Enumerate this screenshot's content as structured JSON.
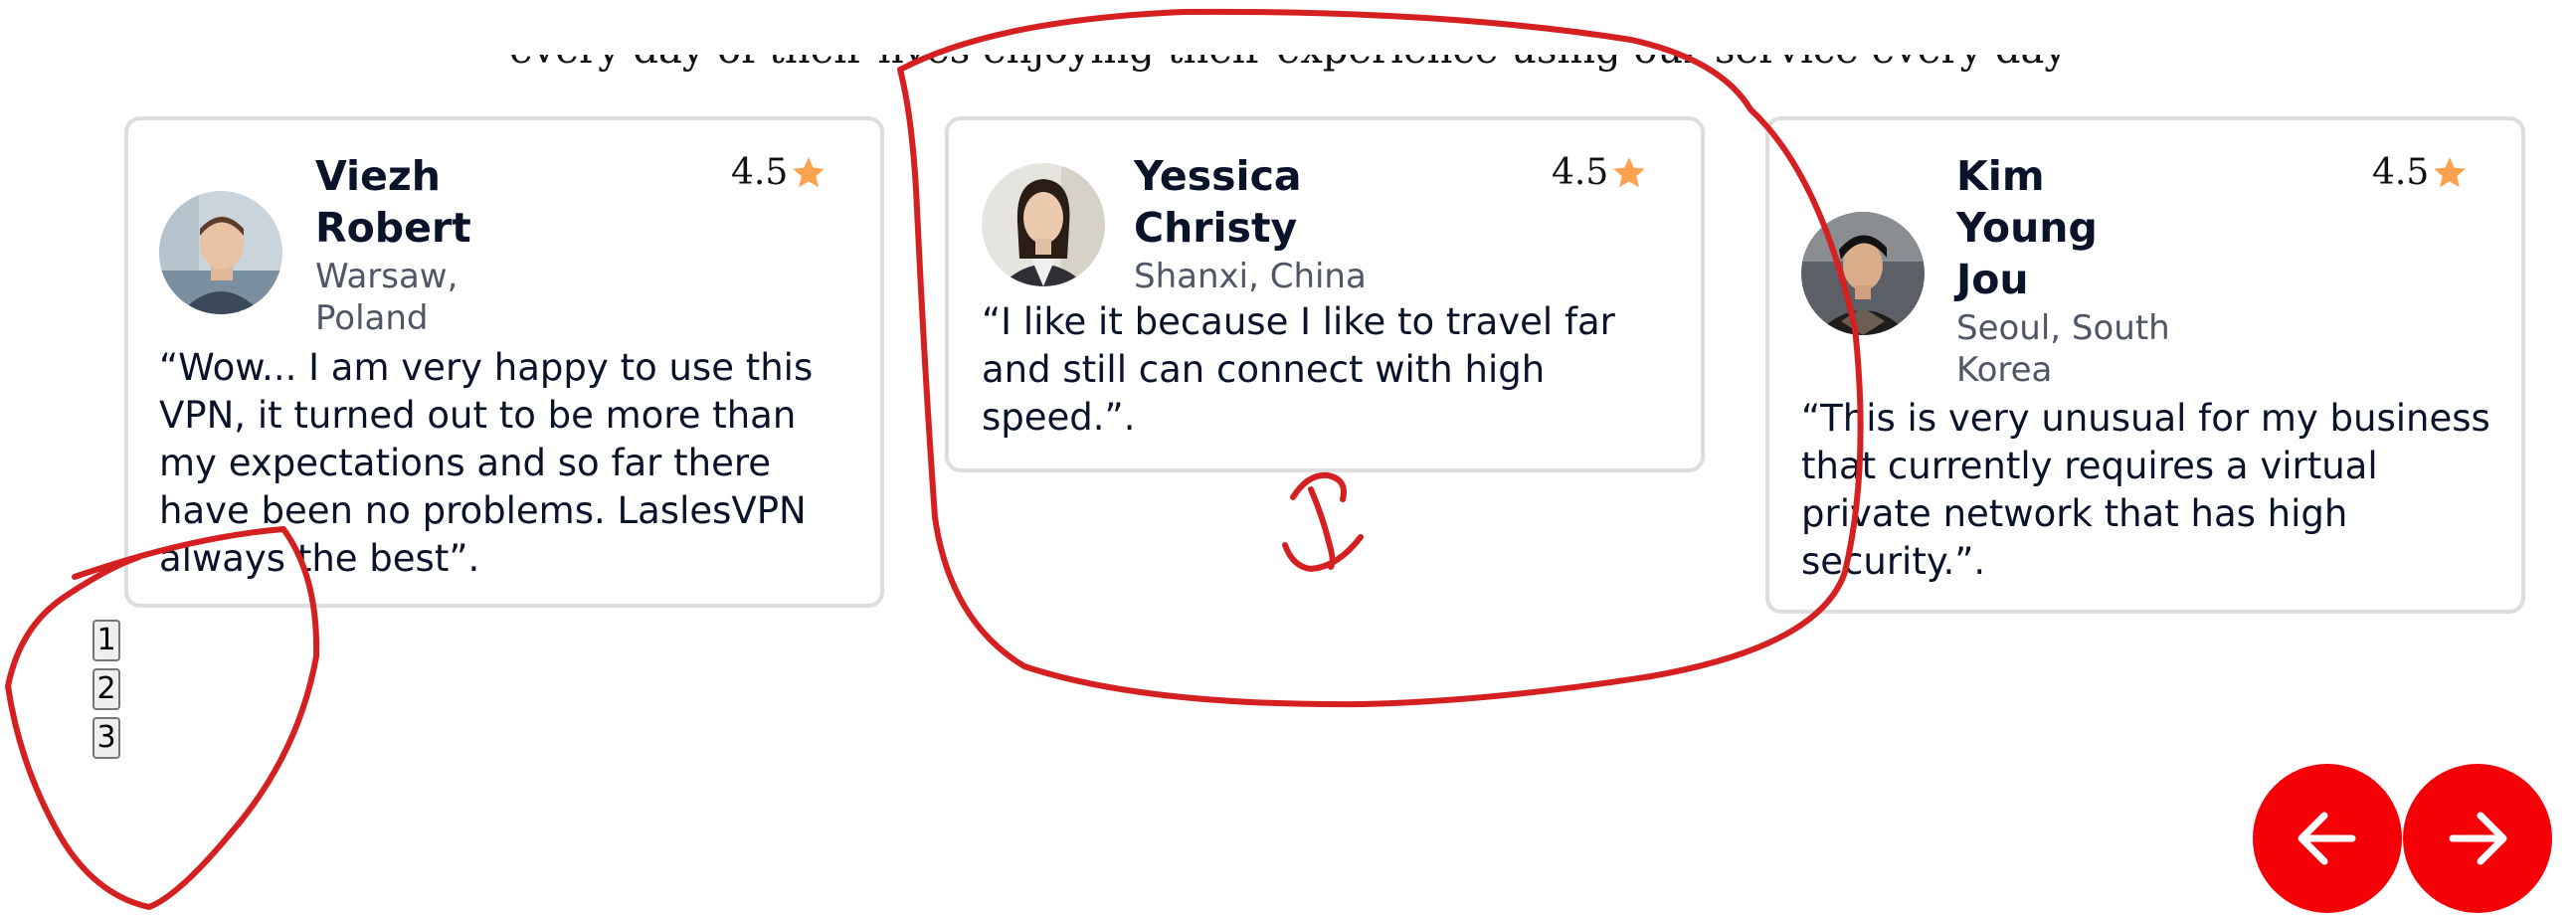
{
  "section_heading_fragment": "every day of their lives enjoying their experience using our service every day",
  "testimonials": [
    {
      "name_line1": "Viezh",
      "name_line2": "Robert",
      "location_line1": "Warsaw,",
      "location_line2": "Poland",
      "rating": "4.5",
      "quote_line1": "“Wow... I am very happy to use this",
      "quote_line2": "VPN, it turned out to be more than",
      "quote_line3": "my expectations and so far there",
      "quote_line4": "have been no problems. LaslesVPN",
      "quote_line5": "always the best”."
    },
    {
      "name_line1": "Yessica",
      "name_line2": "Christy",
      "location_line1": "Shanxi, China",
      "rating": "4.5",
      "quote_line1": "“I like it because I like to travel far",
      "quote_line2": "and still can connect with high",
      "quote_line3": "speed.”."
    },
    {
      "name_line1": "Kim",
      "name_line2": "Young",
      "name_line3": "Jou",
      "location_line1": "Seoul, South",
      "location_line2": "Korea",
      "rating": "4.5",
      "quote_line1": "“This is very unusual for my business",
      "quote_line2": "that currently requires a virtual",
      "quote_line3": "private network that has high",
      "quote_line4": "security.”."
    }
  ],
  "pagination": [
    "1",
    "2",
    "3"
  ],
  "navigation": {
    "prev_icon": "arrow-left-icon",
    "next_icon": "arrow-right-icon"
  },
  "colors": {
    "accent_red": "#f60008",
    "star": "#fea250",
    "card_border": "#dddddd",
    "annotation_red": "#d42020",
    "name_text": "#0b132a",
    "location_text": "#4f5665"
  }
}
